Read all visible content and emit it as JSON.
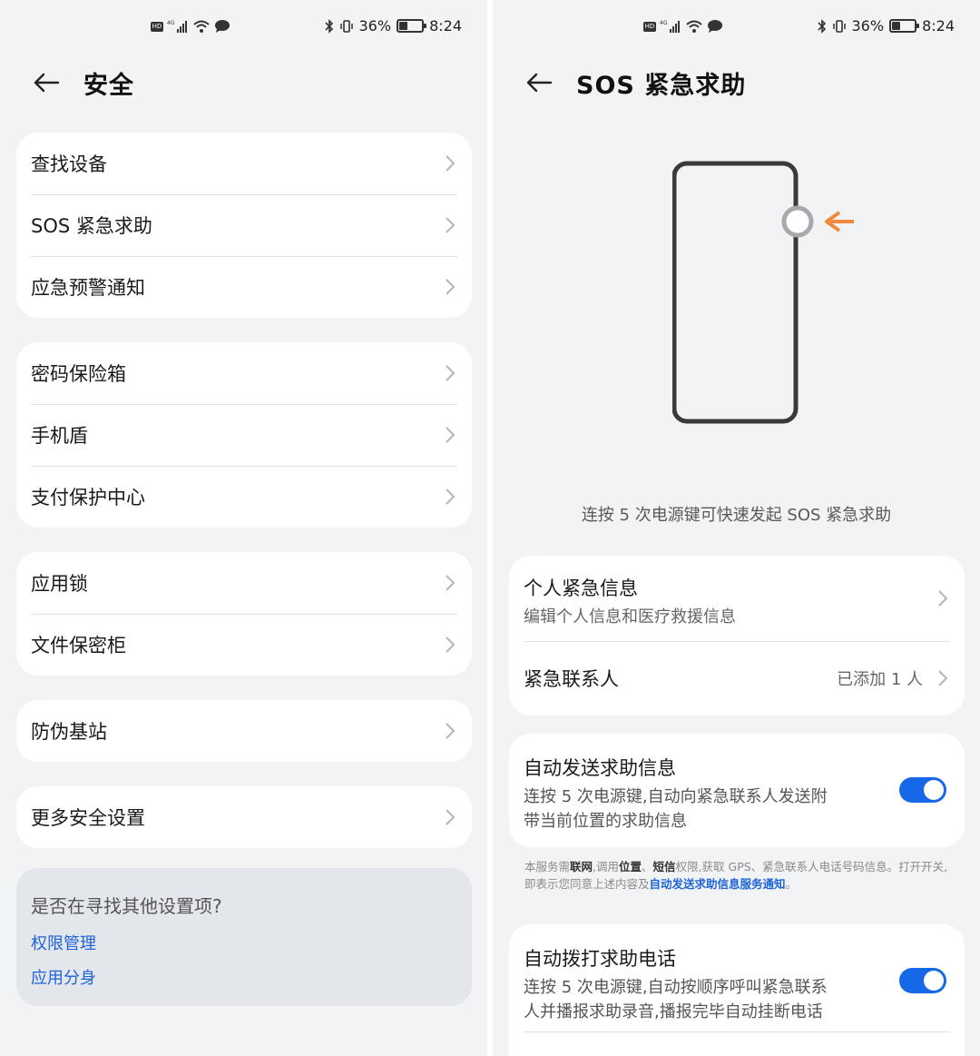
{
  "left": {
    "status": {
      "battery": "36%",
      "time": "8:24",
      "battery_level": 0.36
    },
    "header": {
      "title": "安全"
    },
    "groups": [
      {
        "items": [
          {
            "label": "查找设备"
          },
          {
            "label": "SOS 紧急求助"
          },
          {
            "label": "应急预警通知"
          }
        ]
      },
      {
        "items": [
          {
            "label": "密码保险箱"
          },
          {
            "label": "手机盾"
          },
          {
            "label": "支付保护中心"
          }
        ]
      },
      {
        "items": [
          {
            "label": "应用锁"
          },
          {
            "label": "文件保密柜"
          }
        ]
      },
      {
        "items": [
          {
            "label": "防伪基站"
          }
        ]
      },
      {
        "items": [
          {
            "label": "更多安全设置"
          }
        ]
      }
    ],
    "hint": {
      "title": "是否在寻找其他设置项?",
      "links": [
        "权限管理",
        "应用分身"
      ]
    }
  },
  "right": {
    "status": {
      "battery": "36%",
      "time": "8:24",
      "battery_level": 0.36
    },
    "header": {
      "title": "SOS 紧急求助"
    },
    "caption": "连按 5 次电源键可快速发起 SOS 紧急求助",
    "personal": {
      "info_title": "个人紧急信息",
      "info_subtitle": "编辑个人信息和医疗救援信息",
      "contacts_title": "紧急联系人",
      "contacts_value": "已添加 1 人"
    },
    "auto_message": {
      "title": "自动发送求助信息",
      "desc_line1": "连按 5 次电源键,自动向紧急联系人发送附",
      "desc_line2": "带当前位置的求助信息",
      "enabled": true
    },
    "notice": {
      "t1": "本服务需",
      "b1": "联网",
      "t2": ",调用",
      "b2": "位置",
      "t3": "、",
      "b3": "短信",
      "t4": "权限,获取 GPS、紧急联系人电话号码信息。打开开关,即表示您同意上述内容及",
      "link": "自动发送求助信息服务通知",
      "t5": "。"
    },
    "auto_call": {
      "title": "自动拨打求助电话",
      "desc_line1": "连按 5 次电源键,自动按顺序呼叫紧急联系",
      "desc_line2": "人并播报求助录音,播报完毕自动挂断电话",
      "enabled": true
    }
  },
  "colors": {
    "accent": "#1668e8",
    "link": "#1d63d9",
    "background": "#f1f3f5",
    "card": "#ffffff",
    "arrow": "#f08a3a"
  }
}
